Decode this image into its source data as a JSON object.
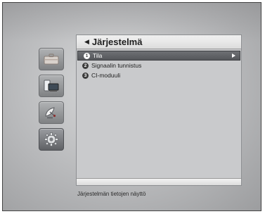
{
  "panel": {
    "title": "Järjestelmä"
  },
  "menu": {
    "items": [
      {
        "number": "1",
        "label": "Tila"
      },
      {
        "number": "2",
        "label": "Signaalin tunnistus"
      },
      {
        "number": "3",
        "label": "CI-moduuli"
      }
    ]
  },
  "help_text": "Järjestelmän tietojen näyttö",
  "side_icons": [
    "toolbox-icon",
    "devices-icon",
    "satellite-dish-icon",
    "gear-icon"
  ],
  "colors": {
    "selected_bg": "#5f6165",
    "header_bg": "#e8e8e8",
    "panel_bg": "#c9cacc"
  }
}
